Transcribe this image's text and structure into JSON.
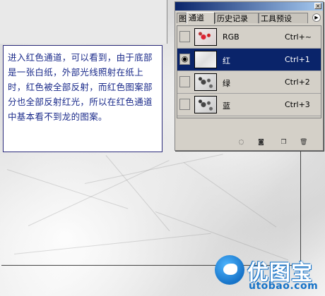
{
  "note": {
    "text": "进入红色通道，可以看到，由于底部是一张白纸，外部光线照射在纸上时，红色被全部反射，而红色图案部分也全部反射红光，所以在红色通道中基本看不到龙的图案。"
  },
  "panel": {
    "tabs": [
      {
        "label": "图层",
        "active": false
      },
      {
        "label": "通道",
        "active": true
      },
      {
        "label": "历史记录",
        "active": false
      },
      {
        "label": "工具预设",
        "active": false
      }
    ],
    "channels": [
      {
        "name": "RGB",
        "shortcut": "Ctrl+~",
        "visible": false,
        "selected": false,
        "thumb": "rgb"
      },
      {
        "name": "红",
        "shortcut": "Ctrl+1",
        "visible": true,
        "selected": true,
        "thumb": "red"
      },
      {
        "name": "绿",
        "shortcut": "Ctrl+2",
        "visible": false,
        "selected": false,
        "thumb": "gray"
      },
      {
        "name": "蓝",
        "shortcut": "Ctrl+3",
        "visible": false,
        "selected": false,
        "thumb": "gray"
      }
    ],
    "bottom_icons": [
      "load-selection-icon",
      "save-selection-icon",
      "new-channel-icon",
      "delete-channel-icon"
    ],
    "colors": {
      "selection": "#0a246a",
      "panel_bg": "#d4d0c8"
    }
  },
  "watermark": {
    "brand": "优图宝",
    "url": "utobao.com"
  }
}
